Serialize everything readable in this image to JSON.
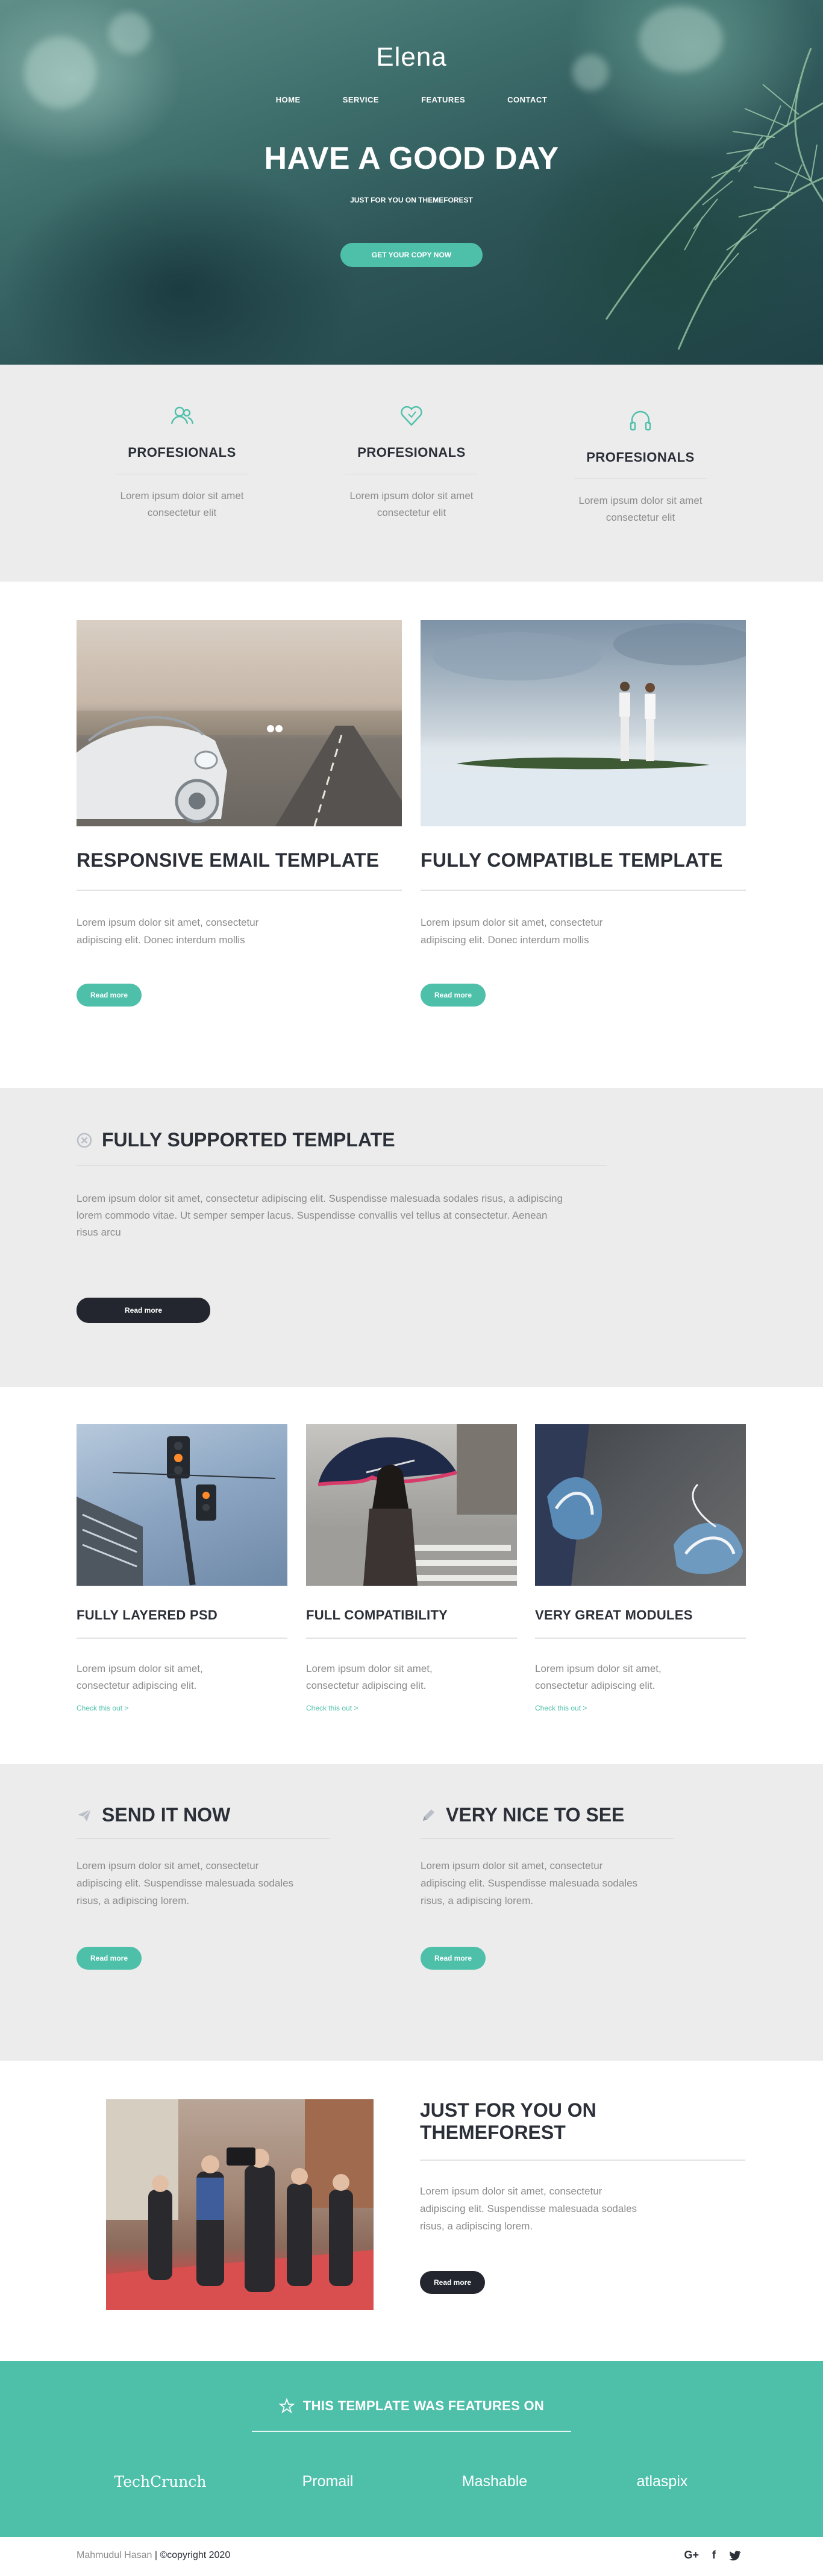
{
  "hero": {
    "logo": "Elena",
    "nav": [
      "HOME",
      "SERVICE",
      "FEATURES",
      "CONTACT"
    ],
    "title": "HAVE A GOOD DAY",
    "subtitle": "JUST FOR YOU ON THEMEFOREST",
    "cta": "GET YOUR COPY NOW"
  },
  "features": [
    {
      "icon": "users-icon",
      "title": "PROFESIONALS",
      "text": "Lorem ipsum dolor sit amet consectetur elit"
    },
    {
      "icon": "heart-icon",
      "title": "PROFESIONALS",
      "text": "Lorem ipsum dolor sit amet consectetur elit"
    },
    {
      "icon": "headphones-icon",
      "title": "PROFESIONALS",
      "text": "Lorem ipsum dolor sit amet consectetur elit"
    }
  ],
  "two_col": [
    {
      "title": "RESPONSIVE EMAIL TEMPLATE",
      "text": "Lorem ipsum dolor sit amet, consectetur adipiscing elit. Donec interdum mollis",
      "button": "Read more"
    },
    {
      "title": "FULLY COMPATIBLE TEMPLATE",
      "text": "Lorem ipsum dolor sit amet, consectetur adipiscing elit. Donec interdum mollis",
      "button": "Read more"
    }
  ],
  "supported": {
    "icon": "close-circle-icon",
    "title": "FULLY SUPPORTED TEMPLATE",
    "text": "Lorem ipsum dolor sit amet, consectetur adipiscing elit. Suspendisse malesuada sodales risus, a adipiscing lorem commodo vitae. Ut semper semper lacus. Suspendisse convallis vel tellus at consectetur. Aenean risus arcu",
    "button": "Read more"
  },
  "three_col": [
    {
      "title": "FULLY LAYERED PSD",
      "text": "Lorem ipsum dolor sit amet, consectetur adipiscing elit.",
      "link": "Check this out >"
    },
    {
      "title": "FULL COMPATIBILITY",
      "text": "Lorem ipsum dolor sit amet, consectetur adipiscing elit.",
      "link": "Check this out >"
    },
    {
      "title": "VERY GREAT MODULES",
      "text": "Lorem ipsum dolor sit amet, consectetur adipiscing elit.",
      "link": "Check this out >"
    }
  ],
  "send": [
    {
      "icon": "paper-plane-icon",
      "title": "SEND IT NOW",
      "text": "Lorem ipsum dolor sit amet, consectetur adipiscing elit. Suspendisse malesuada sodales risus, a adipiscing lorem.",
      "button": "Read more"
    },
    {
      "icon": "pencil-icon",
      "title": "VERY NICE TO SEE",
      "text": "Lorem ipsum dolor sit amet, consectetur adipiscing elit. Suspendisse malesuada sodales risus, a adipiscing lorem.",
      "button": "Read more"
    }
  ],
  "themeforest": {
    "title": "JUST FOR YOU ON THEMEFOREST",
    "text": "Lorem ipsum dolor sit amet, consectetur adipiscing elit. Suspendisse malesuada sodales risus, a adipiscing lorem.",
    "button": "Read more"
  },
  "featured": {
    "icon": "star-icon",
    "title": "THIS TEMPLATE WAS FEATURES ON",
    "logos": [
      "TechCrunch",
      "Promail",
      "Mashable",
      "atlaspix"
    ]
  },
  "footer": {
    "author": "Mahmudul Hasan",
    "separator": "|",
    "copyright": "©copyright 2020",
    "social": [
      "G+",
      "f",
      "t"
    ]
  },
  "colors": {
    "accent": "#4ec0aa",
    "dark": "#23262e",
    "section_gray": "#ececec",
    "muted_text": "#8c8c8c"
  }
}
